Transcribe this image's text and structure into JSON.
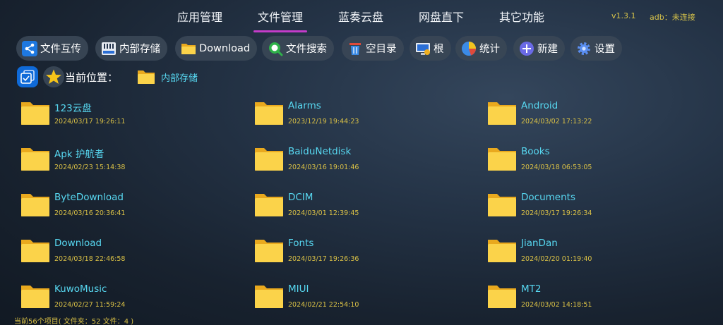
{
  "nav": {
    "tabs": [
      {
        "label": "应用管理",
        "active": false
      },
      {
        "label": "文件管理",
        "active": true
      },
      {
        "label": "蓝奏云盘",
        "active": false
      },
      {
        "label": "网盘直下",
        "active": false
      },
      {
        "label": "其它功能",
        "active": false
      }
    ],
    "version": "v1.3.1",
    "adb_status": "adb：未连接"
  },
  "toolbar": {
    "buttons": [
      {
        "label": "文件互传",
        "icon": "share-icon"
      },
      {
        "label": "内部存储",
        "icon": "storage-icon"
      },
      {
        "label": "Download",
        "icon": "folder-icon"
      },
      {
        "label": "文件搜索",
        "icon": "search-icon"
      },
      {
        "label": "空目录",
        "icon": "trash-icon"
      },
      {
        "label": "根",
        "icon": "root-icon"
      },
      {
        "label": "统计",
        "icon": "pie-chart-icon"
      },
      {
        "label": "新建",
        "icon": "plus-icon"
      },
      {
        "label": "设置",
        "icon": "gear-icon"
      }
    ]
  },
  "location": {
    "label": "当前位置：",
    "path": "内部存储"
  },
  "files": [
    {
      "name": "123云盘",
      "date": "2024/03/17 19:26:11"
    },
    {
      "name": "Alarms",
      "date": "2023/12/19 19:44:23"
    },
    {
      "name": "Android",
      "date": "2024/03/02 17:13:22"
    },
    {
      "name": "Apk 护航者",
      "date": "2024/02/23 15:14:38"
    },
    {
      "name": "BaiduNetdisk",
      "date": "2024/03/16 19:01:46"
    },
    {
      "name": "Books",
      "date": "2024/03/18 06:53:05"
    },
    {
      "name": "ByteDownload",
      "date": "2024/03/16 20:36:41"
    },
    {
      "name": "DCIM",
      "date": "2024/03/01 12:39:45"
    },
    {
      "name": "Documents",
      "date": "2024/03/17 19:26:34"
    },
    {
      "name": "Download",
      "date": "2024/03/18 22:46:58"
    },
    {
      "name": "Fonts",
      "date": "2024/03/17 19:26:36"
    },
    {
      "name": "JianDan",
      "date": "2024/02/20 01:19:40"
    },
    {
      "name": "KuwoMusic",
      "date": "2024/02/27 11:59:24"
    },
    {
      "name": "MIUI",
      "date": "2024/02/21 22:54:10"
    },
    {
      "name": "MT2",
      "date": "2024/03/02 14:18:51"
    }
  ],
  "status": "当前56个项目( 文件夹：52   文件：4 )",
  "colors": {
    "accent": "#c33cc9",
    "filename": "#57d7f0",
    "date": "#d9c046",
    "button_bg": "#3a4656"
  }
}
